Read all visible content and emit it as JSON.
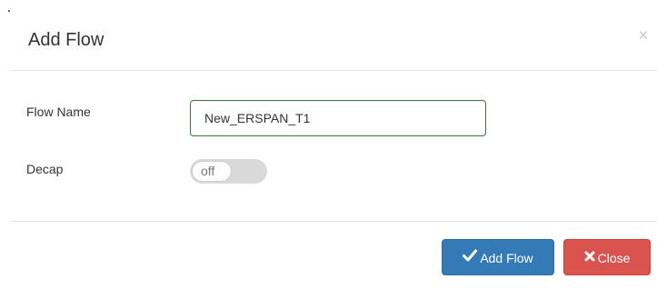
{
  "dialog": {
    "title": "Add Flow",
    "close_glyph": "×"
  },
  "form": {
    "flow_name": {
      "label": "Flow Name",
      "value": "New_ERSPAN_T1"
    },
    "decap": {
      "label": "Decap",
      "state_text": "off",
      "enabled": false
    }
  },
  "footer": {
    "add_flow_label": "Add Flow",
    "close_label": "Close",
    "add_icon": "checkmark-icon",
    "close_icon": "x-icon"
  },
  "colors": {
    "primary": "#337ab7",
    "danger": "#d9534f",
    "input_border_success": "#3c763d",
    "toggle_off_bg": "#d9d9d9"
  }
}
